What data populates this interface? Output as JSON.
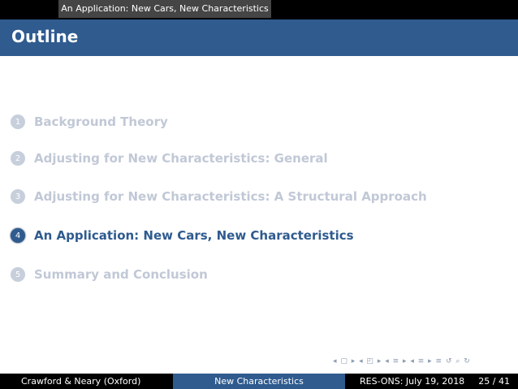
{
  "header": {
    "section": "An Application: New Cars, New Characteristics"
  },
  "title": "Outline",
  "toc": [
    {
      "num": "1",
      "label": "Background Theory",
      "state": "dim"
    },
    {
      "num": "2",
      "label": "Adjusting for New Characteristics: General",
      "state": "dim"
    },
    {
      "num": "3",
      "label": "Adjusting for New Characteristics: A Structural Approach",
      "state": "dim"
    },
    {
      "num": "4",
      "label": "An Application: New Cars, New Characteristics",
      "state": "active"
    },
    {
      "num": "5",
      "label": "Summary and Conclusion",
      "state": "dim"
    }
  ],
  "nav": {
    "symbols": "◂ ▢ ▸ ◂ ◰ ▸ ◂ ≡ ▸ ◂ ≡ ▸ ≡ ↺ ⌕ ↻"
  },
  "footer": {
    "authors": "Crawford & Neary (Oxford)",
    "short_title": "New Characteristics",
    "venue": "RES-ONS: July 19, 2018",
    "page": "25 / 41"
  },
  "colors": {
    "accent": "#2f5b8f",
    "dim": "#c1c8d6"
  }
}
